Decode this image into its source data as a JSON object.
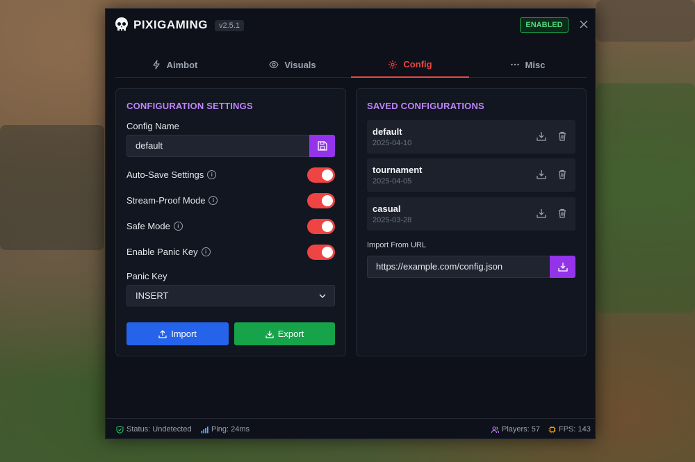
{
  "app": {
    "title": "PIXIGAMING",
    "version": "v2.5.1",
    "status_badge": "ENABLED"
  },
  "tabs": [
    {
      "label": "Aimbot",
      "icon": "lightning-icon",
      "active": false
    },
    {
      "label": "Visuals",
      "icon": "eye-icon",
      "active": false
    },
    {
      "label": "Config",
      "icon": "gear-icon",
      "active": true
    },
    {
      "label": "Misc",
      "icon": "ellipsis-icon",
      "active": false
    }
  ],
  "config": {
    "title": "CONFIGURATION SETTINGS",
    "name_label": "Config Name",
    "name_value": "default",
    "toggles": [
      {
        "label": "Auto-Save Settings",
        "on": true
      },
      {
        "label": "Stream-Proof Mode",
        "on": true
      },
      {
        "label": "Safe Mode",
        "on": true
      },
      {
        "label": "Enable Panic Key",
        "on": true
      }
    ],
    "panic_label": "Panic Key",
    "panic_value": "INSERT",
    "import_label": "Import",
    "export_label": "Export"
  },
  "saved": {
    "title": "SAVED CONFIGURATIONS",
    "items": [
      {
        "name": "default",
        "date": "2025-04-10"
      },
      {
        "name": "tournament",
        "date": "2025-04-05"
      },
      {
        "name": "casual",
        "date": "2025-03-28"
      }
    ],
    "url_label": "Import From URL",
    "url_value": "https://example.com/config.json"
  },
  "footer": {
    "status": "Status: Undetected",
    "ping": "Ping: 24ms",
    "players": "Players: 57",
    "fps": "FPS: 143"
  },
  "colors": {
    "accent_red": "#ef4444",
    "purple": "#9333ea",
    "title_purple": "#c084fc",
    "import_blue": "#2563eb",
    "export_green": "#16a34a"
  }
}
